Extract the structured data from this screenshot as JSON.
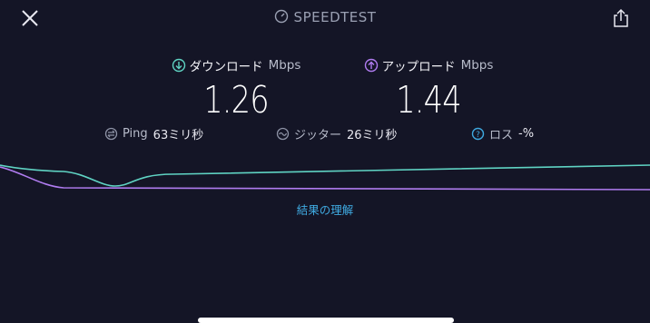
{
  "header": {
    "title": "SPEEDTEST"
  },
  "download": {
    "label": "ダウンロード",
    "unit": "Mbps",
    "value": "1.26",
    "color": "#5fd3c3"
  },
  "upload": {
    "label": "アップロード",
    "unit": "Mbps",
    "value": "1.44",
    "color": "#b07cf0"
  },
  "stats": {
    "ping_label": "Ping",
    "ping_value": "63ミリ秒",
    "jitter_label": "ジッター",
    "jitter_value": "26ミリ秒",
    "loss_label": "ロス",
    "loss_value": "-%"
  },
  "results_link": "結果の理解",
  "colors": {
    "background": "#141526",
    "accent_link": "#3fa9e0"
  }
}
